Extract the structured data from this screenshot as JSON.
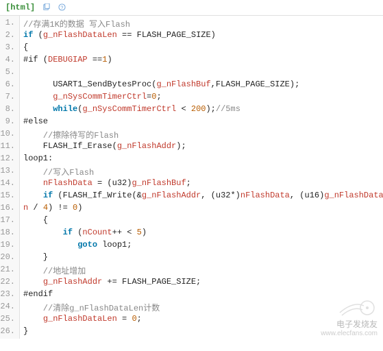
{
  "header": {
    "tag": "[html]"
  },
  "gutter": [
    "1.",
    "2.",
    "3.",
    "4.",
    "5.",
    "6.",
    "7.",
    "8.",
    "9.",
    "10.",
    "11.",
    "12.",
    "13.",
    "14.",
    "15.",
    "16.",
    "17.",
    "18.",
    "19.",
    "20.",
    "21.",
    "22.",
    "23.",
    "24.",
    "25.",
    "26."
  ],
  "code": {
    "l1": "//存满1K的数据 写入Flash",
    "l2_kw": "if",
    "l2_a": " (",
    "l2_v": "g_nFlashDataLen",
    "l2_b": " == FLASH_PAGE_SIZE)",
    "l3": "{",
    "l4_a": "#if (",
    "l4_v": "DEBUGIAP",
    "l4_b": " ==",
    "l4_n": "1",
    "l4_c": ")",
    "l6_a": "      USART1_SendBytesProc(",
    "l6_v": "g_nFlashBuf",
    "l6_b": ",FLASH_PAGE_SIZE);",
    "l7_a": "      ",
    "l7_v": "g_nSysCommTimerCtrl",
    "l7_b": "=",
    "l7_n": "0",
    "l7_c": ";",
    "l8_kw": "while",
    "l8_a": "      ",
    "l8_b": "(",
    "l8_v": "g_nSysCommTimerCtrl",
    "l8_c": " < ",
    "l8_n": "200",
    "l8_d": ");",
    "l8_cm": "//5ms",
    "l9": "#else",
    "l10": "    //擦除待写的Flash",
    "l11_a": "    FLASH_If_Erase(",
    "l11_v": "g_nFlashAddr",
    "l11_b": ");",
    "l12": "loop1:",
    "l13": "    //写入Flash",
    "l14_a": "    ",
    "l14_v1": "nFlashData",
    "l14_b": " = (u32)",
    "l14_v2": "g_nFlashBuf",
    "l14_c": ";",
    "l15_kw": "if",
    "l15_a": "    ",
    "l15_b": " (FLASH_If_Write(&",
    "l15_v1": "g_nFlashAddr",
    "l15_c": ", (u32*)",
    "l15_v2": "nFlashData",
    "l15_d": ", (u16)",
    "l15_v3": "g_nFlashDataLe",
    "l15b_v": "n",
    "l15b_a": " / ",
    "l15b_n1": "4",
    "l15b_b": ") != ",
    "l15b_n2": "0",
    "l15b_c": ")",
    "l16": "    {",
    "l17_kw": "if",
    "l17_a": "        ",
    "l17_b": " (",
    "l17_v": "nCount",
    "l17_c": "++ < ",
    "l17_n": "5",
    "l17_d": ")",
    "l18_kw": "goto",
    "l18_a": "           ",
    "l18_b": " loop1;",
    "l19": "    }",
    "l20": "    //地址增加",
    "l21_a": "    ",
    "l21_v": "g_nFlashAddr",
    "l21_b": " += FLASH_PAGE_SIZE;",
    "l22": "#endif",
    "l23": "    //清除g_nFlashDataLen计数",
    "l24_a": "    ",
    "l24_v": "g_nFlashDataLen",
    "l24_b": " = ",
    "l24_n": "0",
    "l24_c": ";",
    "l25": "}"
  },
  "watermark": {
    "cn": "电子发烧友",
    "url": "www.elecfans.com"
  }
}
